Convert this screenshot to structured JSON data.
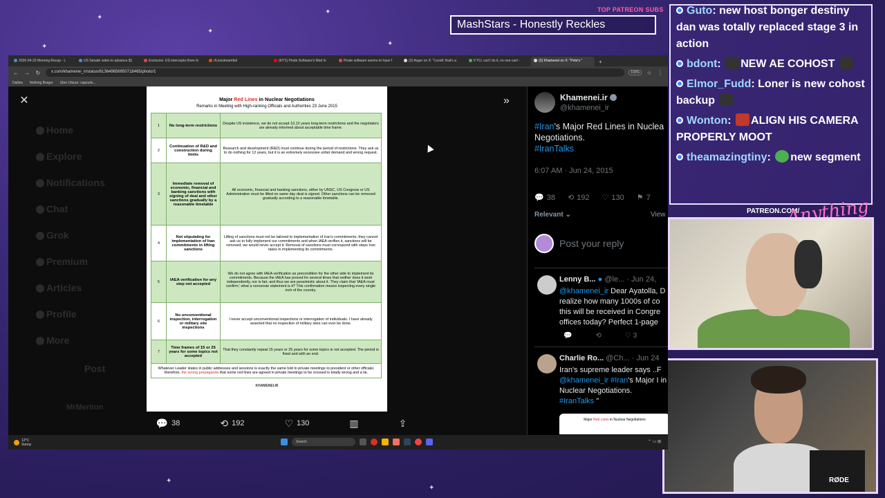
{
  "stream": {
    "patreon_top_label": "TOP PATREON SUBS",
    "ticker_text": "MashStars - Honestly Reckles",
    "patreon_mid_label": "PATREON.COM/",
    "brand_script": "Anything Else"
  },
  "chat": [
    {
      "user": "Guto",
      "text": "new host bonger destiny dan was totally replaced stage 3 in action"
    },
    {
      "user": "bdont",
      "text": "NEW AE COHOST"
    },
    {
      "user": "Elmor_Fudd",
      "text": "Loner is new cohost backup"
    },
    {
      "user": "Wonton",
      "text": "ALIGN HIS CAMERA PROPERLY MOOT"
    },
    {
      "user": "theamazingtiny",
      "text": "new segment"
    }
  ],
  "webcam": {
    "mic_label": "RØDE"
  },
  "browser": {
    "tabs": [
      {
        "label": "2026-04-23 Morning Recap - L"
      },
      {
        "label": "US Senate votes to advance $1"
      },
      {
        "label": "Exclusive: US intercepts three In"
      },
      {
        "label": "r/Livestreamfail"
      },
      {
        "label": "(6/71) Pirate Software's Mod Is"
      },
      {
        "label": "Pirate software seems to have f"
      },
      {
        "label": "(3) Asger on X: \"Lovett: that's a"
      },
      {
        "label": "If YLL can't do it, no one can! -"
      },
      {
        "label": "(3) Khamenei on X: \"Pete's \""
      }
    ],
    "url": "x.com/khamenei_ir/status/613649656950718465/photo/1",
    "zoom": "100%",
    "bookmarks": [
      "Dailies",
      "Nothing Burger",
      "Uber Ulsour: capsulin..."
    ]
  },
  "sidebar_ghost": [
    "Home",
    "Explore",
    "Notifications",
    "Chat",
    "Grok",
    "Premium",
    "Articles",
    "Profile",
    "More",
    "Post",
    "MrMeriton"
  ],
  "document": {
    "title_pre": "Major ",
    "title_red": "Red Lines",
    "title_post": " in Nuclear Negotiations",
    "subtitle": "Remarks in Meeting with High-ranking Officials and Authorities 23 June 2015",
    "rows": [
      {
        "num": "1",
        "title": "No long-term restrictions",
        "desc": "Despite US insistence, we do not accept 10,12 years long-term restrictions and the negotiators are already informed about acceptable time frame."
      },
      {
        "num": "2",
        "title": "Continuation of R&D and construction during limits",
        "desc": "Research and development (R&D) must continue during the period of restrictions. They ask us to do nothing for 12 years, but it is an extremely excessive unfair demand and wrong request."
      },
      {
        "num": "3",
        "title": "Immediate removal of economic, financial and banking sanctions with signing of deal and other sanctions gradually by a reasonable timetable",
        "desc": "All economic, financial and banking sanctions, either by UNSC, US Congress or US Administration must be lifted on same day deal is signed. Other sanctions can be removed gradually according to a reasonable timetable."
      },
      {
        "num": "4",
        "title": "Not stipulating for implementation of Iran commitments in lifting sanctions",
        "desc": "Lifting of sanctions must not be tailored to implementation of Iran's commitments; they cannot ask us to fully implement our commitments and when IAEA verifies it, sanctions will be removed; we would never accept it. Removal of sanctions must correspond with steps Iran takes in implementing its commitments."
      },
      {
        "num": "5",
        "title": "IAEA verification for any step not accepted",
        "desc": "We do not agree with IAEA verification as precondition for the other side to implement its commitments. Because the IAEA has proved for several times that neither does it work independently, nor is fair, and thus we are pessimistic about it. They claim that 'IAEA must confirm;' what a nonsense statement is it? This confirmation means inspecting every single inch of the country."
      },
      {
        "num": "6",
        "title": "No unconventional inspection, interrogation or military site inspections",
        "desc": "I never accept unconventional inspections or interrogation of individuals. I have already asserted that no inspection of military sites can ever be done."
      },
      {
        "num": "7",
        "title": "Time frames of 15 or 25 years for some topics not accepted",
        "desc": "That they constantly repeat 15 years or 25 years for some topics is not accepted. The period is fixed and with an end."
      }
    ],
    "footer_pre": "Whatever Leader states in public addresses and sessions is exactly the same told in private meetings to president or other officials; therefore, ",
    "footer_red": "the wrong propaganda",
    "footer_post": " that some red lines are agreed in private meetings to be crossed is totally wrong and a lie.",
    "logo_text": "KHAMENEI.IR"
  },
  "media_actions": {
    "replies": "38",
    "reposts": "192",
    "likes": "130"
  },
  "tweet": {
    "author": "Khamenei.ir",
    "handle": "@khamenei_ir",
    "hashtag1": "#Iran",
    "text_line1_rest": "'s Major Red Lines in Nuclea",
    "text_line2": "Negotiations.",
    "hashtag2": "#IranTalks",
    "time": "6:07 AM · Jun 24, 2015",
    "replies": "38",
    "reposts": "192",
    "likes": "130",
    "bookmarks": "7",
    "relevant_label": "Relevant",
    "view_label": "View",
    "reply_placeholder": "Post your reply"
  },
  "replies": [
    {
      "name": "Lenny B...",
      "handle": "@le...",
      "date": "· Jun 24,",
      "mention": "@khamenei_ir",
      "body": " Dear Ayatolla, D realize how many 1000s of co this will be received in Congre offices today? Perfect 1-page",
      "like_count": "3"
    },
    {
      "name": "Charlie Ro...",
      "handle": "@Ch...",
      "date": "· Jun 24",
      "body_pre": "Iran's supreme leader says ..F",
      "mention": "@khamenei_ir",
      "hashtag1": "#Iran",
      "body_mid": "'s Major I in Nuclear Negotiations.",
      "hashtag2": "#IranTalks",
      "quote_close": " \""
    }
  ],
  "taskbar": {
    "weather_temp": "12°C",
    "weather_desc": "Sunny",
    "search_placeholder": "Search"
  }
}
